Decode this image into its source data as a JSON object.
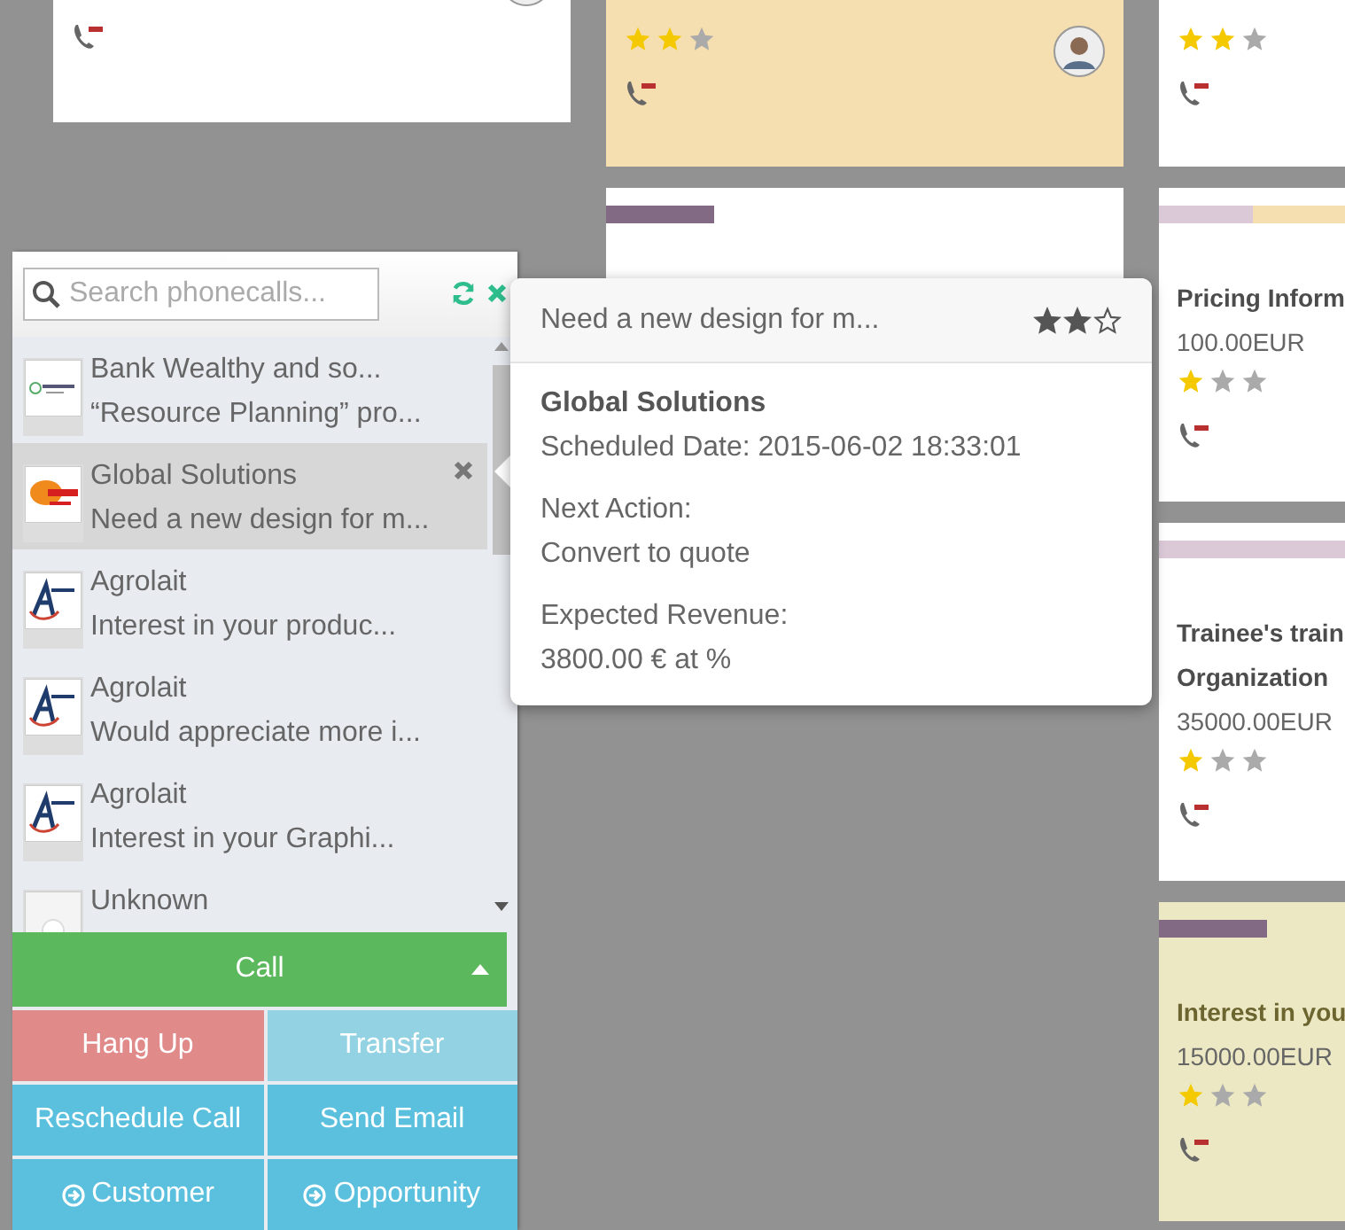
{
  "board": {
    "columns": [
      {
        "cards": [
          {
            "color": "#ffffff",
            "avatar": true,
            "phone": true
          }
        ]
      },
      {
        "cards": [
          {
            "color": "#f5deb0",
            "stars": 2,
            "avatar": true,
            "phone": true
          },
          {
            "color": "#ffffff",
            "tags": [
              {
                "color": "#826a84"
              }
            ]
          }
        ]
      },
      {
        "cards": [
          {
            "color": "#ffffff",
            "stars": 2,
            "phone": true
          },
          {
            "color": "#ffffff",
            "tags": [
              {
                "color": "#dcc9d8"
              },
              {
                "color": "#f5deb0"
              }
            ],
            "title": "Pricing Inform",
            "amount": "100.00EUR",
            "stars": 1,
            "phone": true
          },
          {
            "color": "#ffffff",
            "tags": [
              {
                "color": "#dcc9d8"
              }
            ],
            "title": "Trainee's train",
            "title_2": "Organization",
            "amount": "35000.00EUR",
            "stars": 1,
            "phone": true
          },
          {
            "color": "#ede8c4",
            "tags": [
              {
                "color": "#826a84"
              }
            ],
            "title": "Interest in you",
            "amount": "15000.00EUR",
            "stars": 1,
            "phone": true
          }
        ]
      }
    ]
  },
  "phone_panel": {
    "search": {
      "placeholder": "Search phonecalls..."
    },
    "calls": [
      {
        "kind": "bank",
        "name": "Bank Wealthy and so...",
        "description": "“Resource Planning” pro...",
        "selected": false
      },
      {
        "kind": "globe",
        "name": "Global Solutions",
        "description": "Need a new design for m...",
        "selected": true
      },
      {
        "kind": "letter",
        "name": "Agrolait",
        "description": "Interest in your produc...",
        "selected": false
      },
      {
        "kind": "letter",
        "name": "Agrolait",
        "description": "Would appreciate more i...",
        "selected": false
      },
      {
        "kind": "letter",
        "name": "Agrolait",
        "description": "Interest in your Graphi...",
        "selected": false
      },
      {
        "kind": "blank",
        "name": "Unknown",
        "selected": false
      }
    ],
    "call_button": "Call",
    "actions": [
      {
        "label": "Hang Up",
        "kind": "danger"
      },
      {
        "label": "Transfer",
        "kind": "light"
      },
      {
        "label": "Reschedule Call",
        "kind": "info"
      },
      {
        "label": "Send Email",
        "kind": "info"
      },
      {
        "label": "Customer",
        "kind": "goto"
      },
      {
        "label": "Opportunity",
        "kind": "goto"
      }
    ]
  },
  "popover": {
    "title": "Need a new design for m...",
    "stars": 2,
    "partner": "Global Solutions",
    "scheduled": "Scheduled Date: 2015-06-02 18:33:01",
    "next_action_label": "Next Action:",
    "next_action": "Convert to quote",
    "revenue_label": "Expected Revenue:",
    "revenue": "3800.00 € at %"
  }
}
